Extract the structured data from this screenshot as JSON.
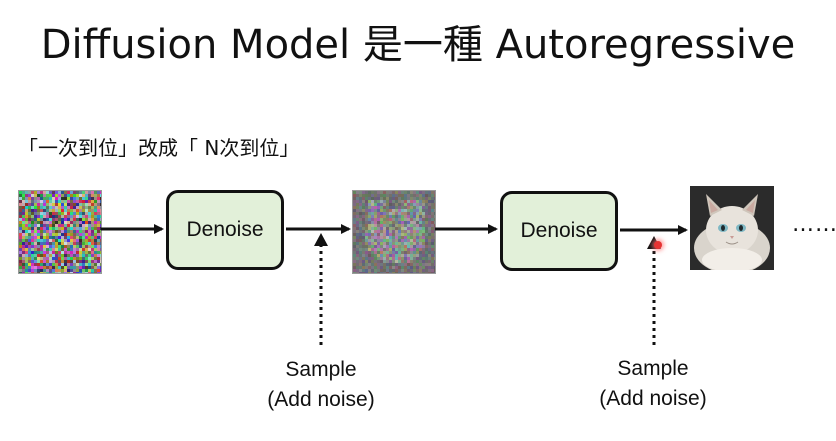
{
  "title": "Diffusion Model 是一種 Autoregressive",
  "subtitle": "「一次到位」改成「 N次到位」",
  "nodes": [
    {
      "label": "Denoise"
    },
    {
      "label": "Denoise"
    }
  ],
  "sample_labels": [
    {
      "line1": "Sample",
      "line2": "(Add noise)"
    },
    {
      "line1": "Sample",
      "line2": "(Add noise)"
    }
  ],
  "ellipsis": "……",
  "colors": {
    "node_fill": "#e2f0d9",
    "node_border": "#111111",
    "arrow": "#111111",
    "text": "#111111"
  }
}
